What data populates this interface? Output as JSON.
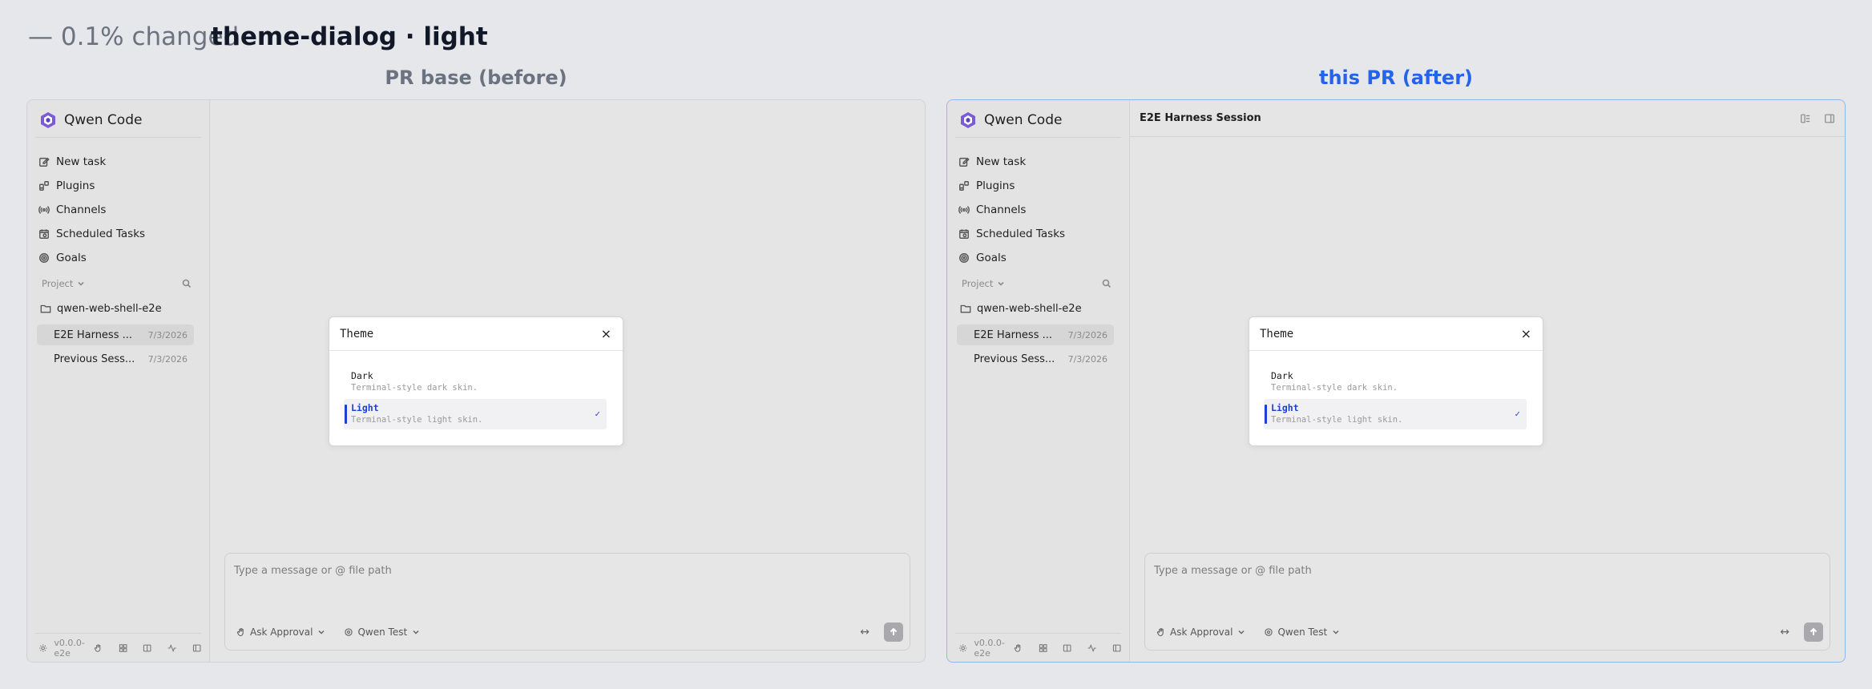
{
  "header": {
    "title": "theme-dialog · light",
    "subtitle": " — 0.1% changed"
  },
  "captions": {
    "before": "PR base (before)",
    "after": "this PR (after)"
  },
  "app": {
    "name": "Qwen Code",
    "nav": [
      "New task",
      "Plugins",
      "Channels",
      "Scheduled Tasks",
      "Goals"
    ],
    "project_label": "Project",
    "folder": "qwen-web-shell-e2e",
    "sessions": [
      {
        "name": "E2E Harness ...",
        "date": "7/3/2026"
      },
      {
        "name": "Previous Sess...",
        "date": "7/3/2026"
      }
    ],
    "version": "v0.0.0-e2e",
    "session_title": "E2E Harness Session"
  },
  "composer": {
    "placeholder": "Type a message or @ file path",
    "approval": "Ask Approval",
    "model": "Qwen Test",
    "expand": "↔"
  },
  "dialog": {
    "title": "Theme",
    "close": "×",
    "options": [
      {
        "name": "Dark",
        "desc": "Terminal-style dark skin."
      },
      {
        "name": "Light",
        "desc": "Terminal-style light skin."
      }
    ],
    "check": "✓"
  },
  "colors": {
    "accent": "#1d3fd4",
    "after_caption": "#2563eb",
    "before_caption": "#6b7280",
    "after_border": "#8fb6f2"
  }
}
